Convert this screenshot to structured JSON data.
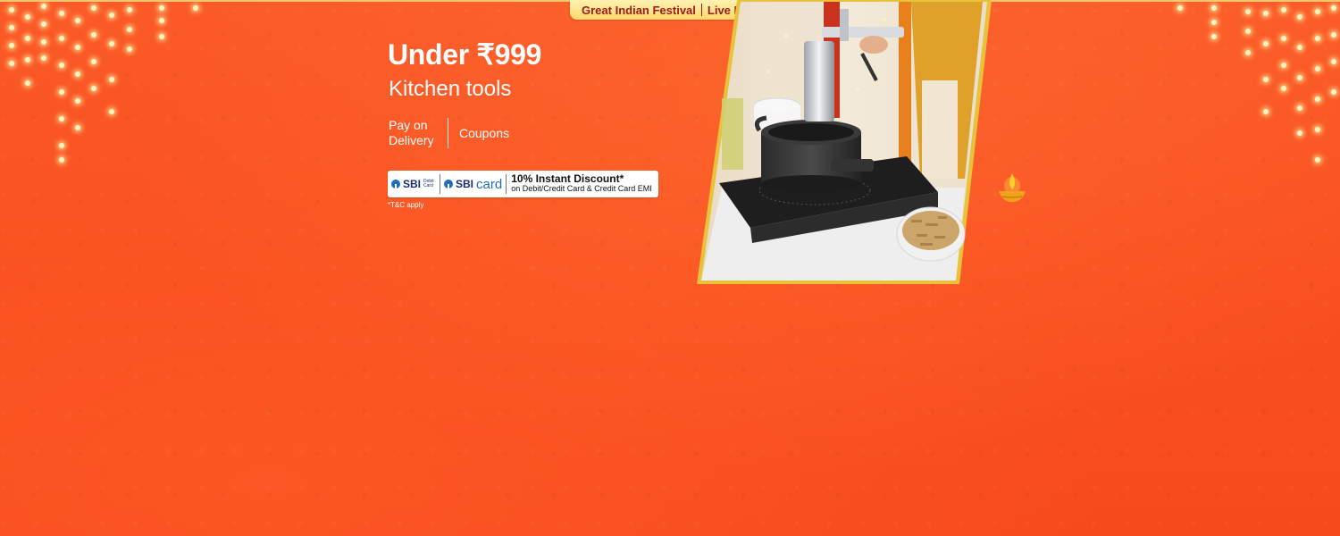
{
  "festival_tag": {
    "event": "Great Indian Festival",
    "status": "Live Now"
  },
  "headline": "Under ₹999",
  "subheadline": "Kitchen tools",
  "benefits": {
    "pay_on_delivery_line1": "Pay on",
    "pay_on_delivery_line2": "Delivery",
    "coupons": "Coupons"
  },
  "bank_offer": {
    "bank_name": "SBI",
    "debit_label_line1": "Debit",
    "debit_label_line2": "Card",
    "card_brand_prefix": "SBI",
    "card_brand_suffix": "card",
    "title": "10% Instant Discount*",
    "subtitle": "on Debit/Credit Card & Credit Card EMI"
  },
  "tnc": "*T&C apply",
  "product_image": {
    "icon": "kitchen-press-induction-photo"
  },
  "decorations": {
    "left_lights_icon": "string-lights-icon",
    "right_lights_icon": "string-lights-icon",
    "diya_icon": "diya-lamp-icon"
  },
  "colors": {
    "background": "#f9501f",
    "tag_bg": "#ffd86a",
    "tag_text": "#9a1b1b",
    "gold_border": "#e8c23a"
  }
}
